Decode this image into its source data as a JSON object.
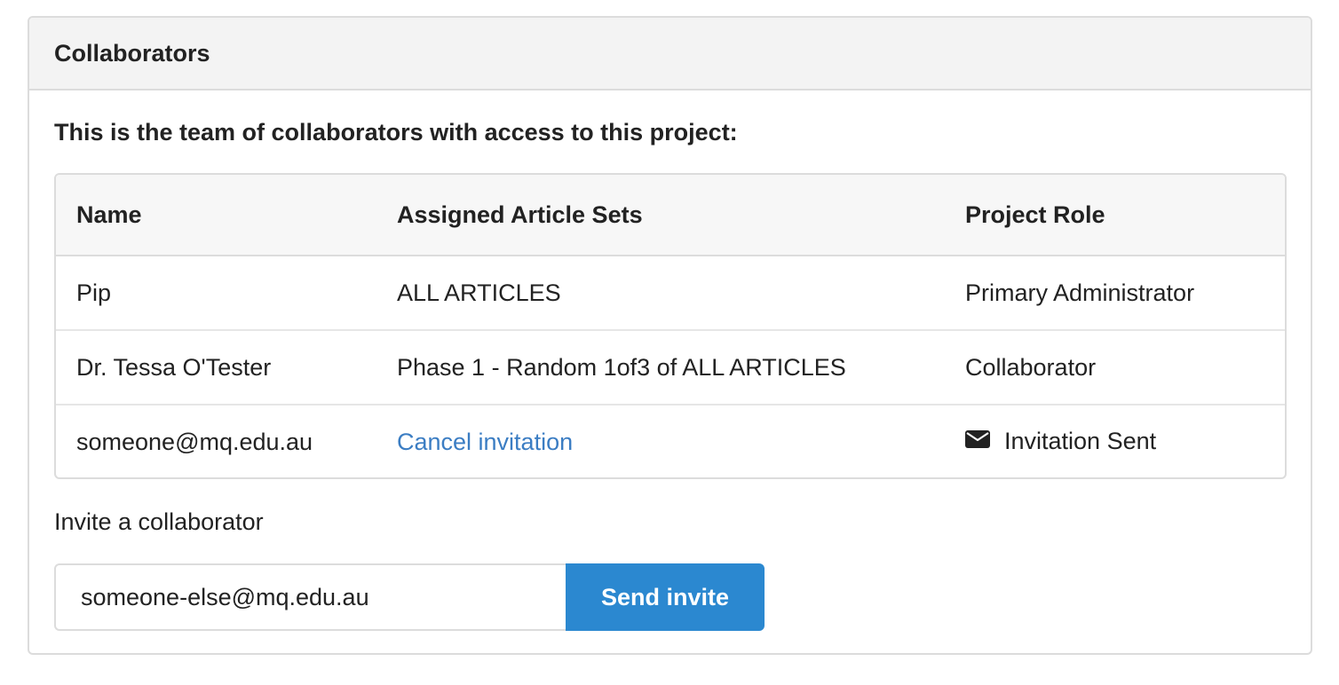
{
  "panel": {
    "title": "Collaborators",
    "intro": "This is the team of collaborators with access to this project:"
  },
  "table": {
    "headers": [
      "Name",
      "Assigned Article Sets",
      "Project Role"
    ],
    "rows": [
      {
        "name": "Pip",
        "article_sets": "ALL ARTICLES",
        "role": "Primary Administrator"
      },
      {
        "name": "Dr. Tessa O'Tester",
        "article_sets": "Phase 1 - Random 1of3 of ALL ARTICLES",
        "role": "Collaborator"
      },
      {
        "name": "someone@mq.edu.au",
        "article_sets": "Cancel invitation",
        "role": "Invitation Sent",
        "role_icon": "envelope-icon"
      }
    ]
  },
  "invite": {
    "label": "Invite a collaborator",
    "input_value": "someone-else@mq.edu.au",
    "button_label": "Send invite"
  },
  "colors": {
    "link": "#3b7dc3",
    "button": "#2b88d0",
    "header_bg": "#f3f3f3"
  }
}
